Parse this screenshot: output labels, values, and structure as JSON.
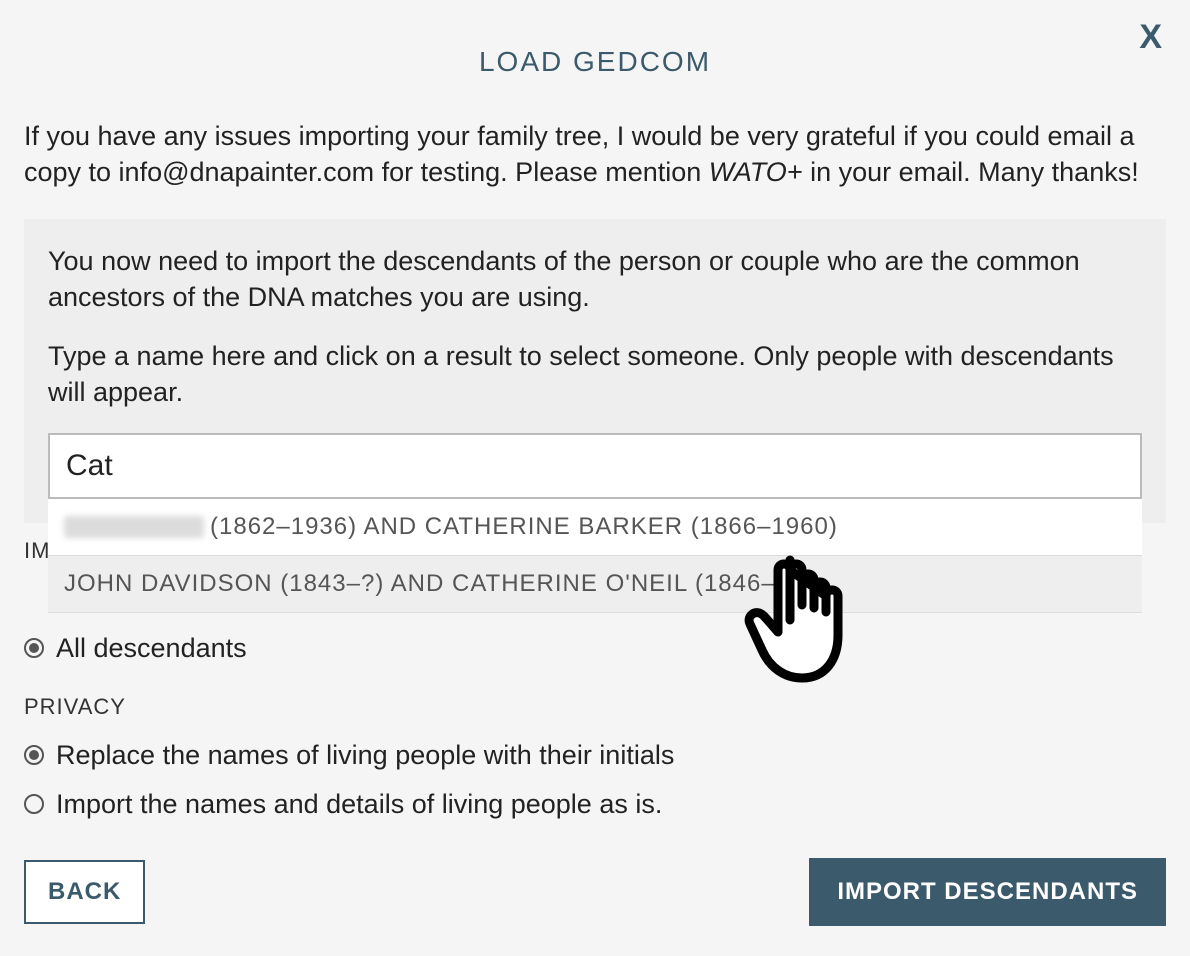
{
  "header": {
    "title": "LOAD GEDCOM",
    "closeLabel": "X"
  },
  "intro": {
    "text_before": "If you have any issues importing your family tree, I would be very grateful if you could email a copy to info@dnapainter.com for testing. Please mention ",
    "em": "WATO+",
    "text_after": " in your email. Many thanks!"
  },
  "panel": {
    "instruction1": "You now need to import the descendants of the person or couple who are the common ancestors of the DNA matches you are using.",
    "instruction2": "Type a name here and click on a result to select someone. Only people with descendants will appear.",
    "searchValue": "Cat"
  },
  "dropdown": {
    "item1_suffix": " (1862–1936) AND CATHERINE BARKER (1866–1960)",
    "item2": "JOHN DAVIDSON (1843–?) AND CATHERINE O'NEIL (1846–?)"
  },
  "sections": {
    "imLabel": "IM",
    "option_allDescendants": "All descendants",
    "privacyLabel": "PRIVACY",
    "option_replaceInitials": "Replace the names of living people with their initials",
    "option_importAsIs": "Import the names and details of living people as is."
  },
  "buttons": {
    "back": "BACK",
    "import": "IMPORT DESCENDANTS"
  }
}
